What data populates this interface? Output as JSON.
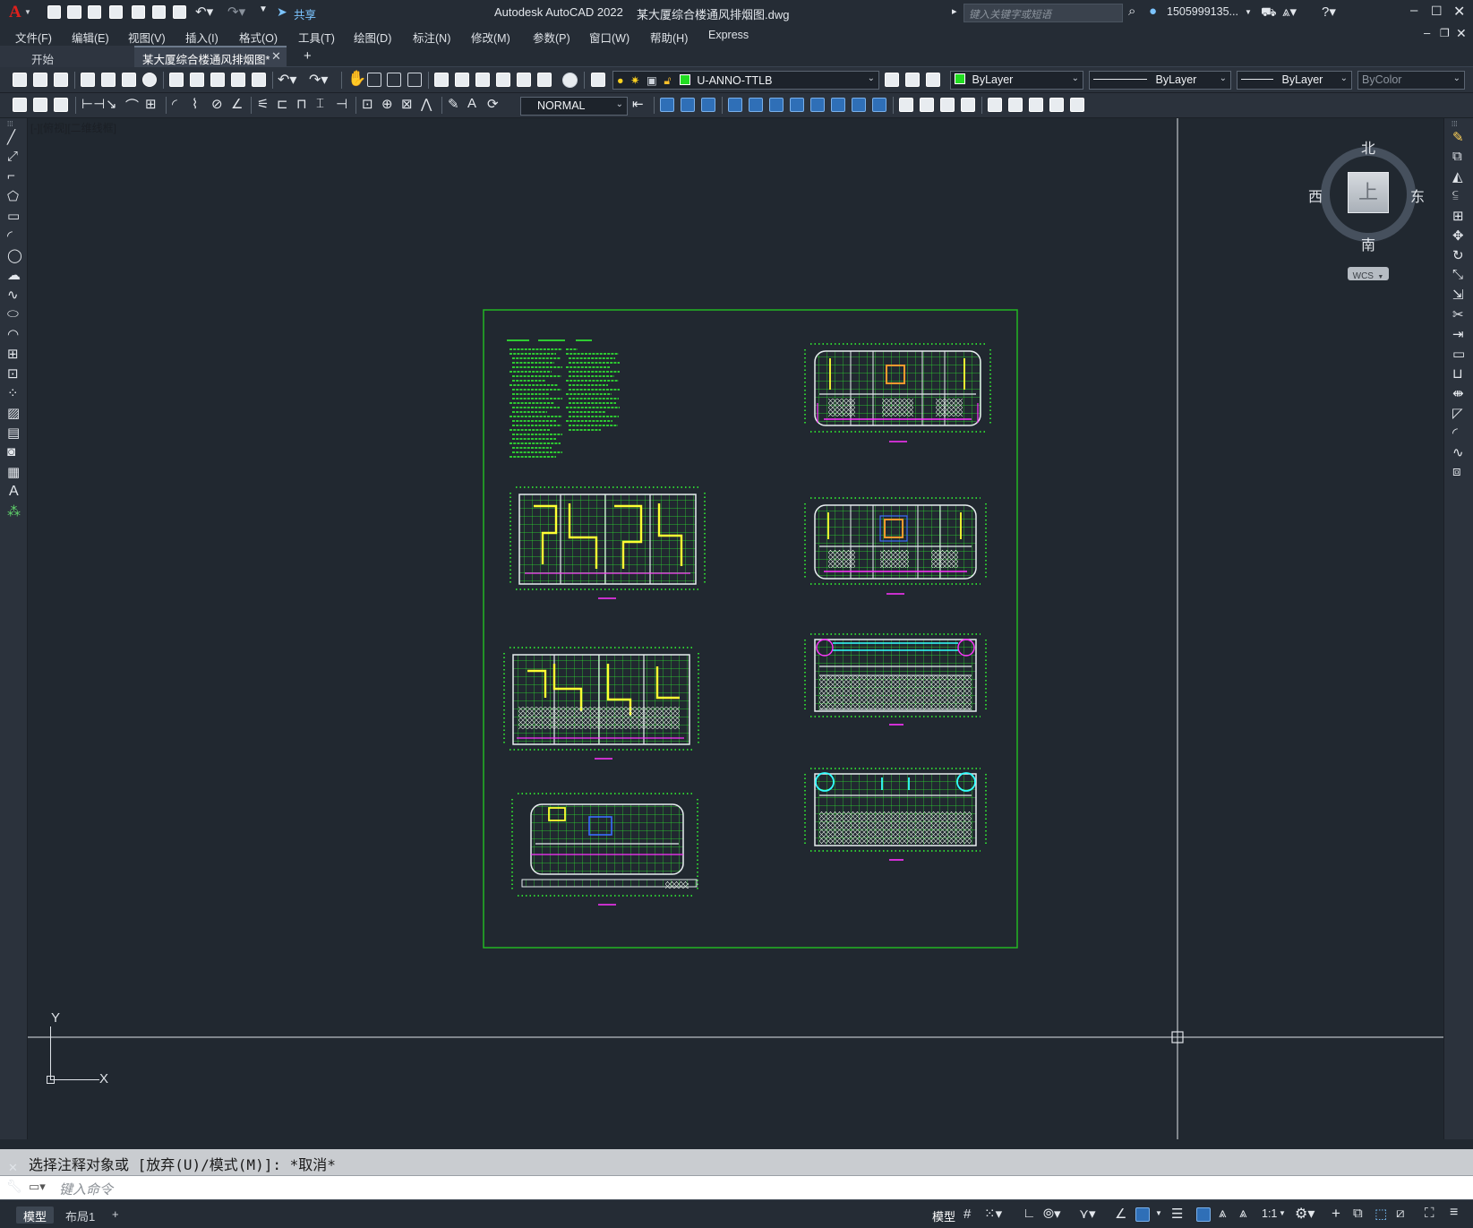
{
  "titlebar": {
    "app_title": "Autodesk AutoCAD 2022",
    "file_title": "某大厦综合楼通风排烟图.dwg",
    "share_label": "共享",
    "search_placeholder": "键入关键字或短语",
    "user": "1505999135...",
    "app_letter": "A"
  },
  "menu": [
    "文件(F)",
    "编辑(E)",
    "视图(V)",
    "插入(I)",
    "格式(O)",
    "工具(T)",
    "绘图(D)",
    "标注(N)",
    "修改(M)",
    "参数(P)",
    "窗口(W)",
    "帮助(H)",
    "Express"
  ],
  "tabs": {
    "start": "开始",
    "active": "某大厦综合楼通风排烟图*",
    "add": "+"
  },
  "toolbar": {
    "layer": "U-ANNO-TTLB",
    "color": "ByLayer",
    "linetype": "ByLayer",
    "lineweight": "ByLayer",
    "plotstyle": "ByColor",
    "dimstyle": "NORMAL"
  },
  "viewport": {
    "label": "[-][俯视][二维线框]",
    "ucs_x": "X",
    "ucs_y": "Y"
  },
  "viewcube": {
    "north": "北",
    "south": "南",
    "east": "东",
    "west": "西",
    "face": "上",
    "wcs": "WCS"
  },
  "command": {
    "history": "选择注释对象或 [放弃(U)/模式(M)]: *取消*",
    "placeholder": "键入命令"
  },
  "status": {
    "tabs": [
      "模型",
      "布局1"
    ],
    "add_tab": "+",
    "model_label": "模型",
    "scale": "1:1"
  },
  "colors": {
    "background": "#212830",
    "drawing_border": "#22b522",
    "drawing_line": "#33ff33",
    "layer_swatch": "#22dd22",
    "accent_yellow": "#ffff33",
    "accent_magenta": "#ff33ff",
    "accent_cyan": "#33ffff"
  }
}
